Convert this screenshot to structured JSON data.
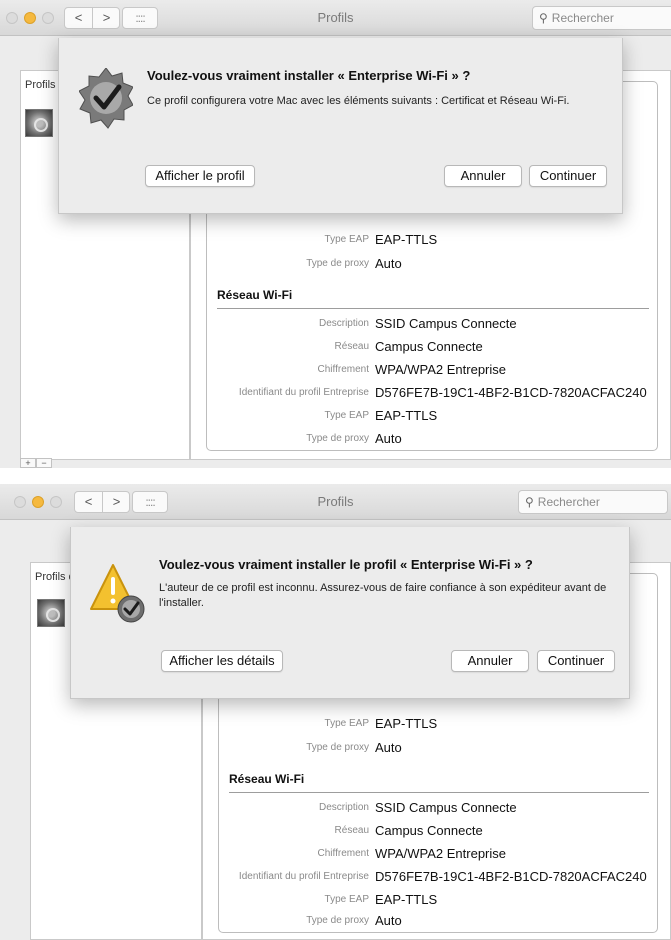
{
  "window": {
    "title": "Profils",
    "search_placeholder": "Rechercher",
    "nav_back": "<",
    "nav_forward": ">",
    "grid": "::::",
    "sidebar_label": "Profils d"
  },
  "dialogs": [
    {
      "title": "Voulez-vous vraiment installer « Enterprise Wi-Fi » ?",
      "body": "Ce profil configurera votre Mac avec les éléments suivants : Certificat et Réseau Wi-Fi.",
      "left_button": "Afficher le profil",
      "cancel_button": "Annuler",
      "continue_button": "Continuer",
      "icon": "checkmark-badge-icon"
    },
    {
      "title": "Voulez-vous vraiment installer le profil « Enterprise Wi-Fi » ?",
      "body": "L'auteur de ce profil est inconnu. Assurez-vous de faire confiance à son expéditeur avant de l'installer.",
      "left_button": "Afficher les détails",
      "cancel_button": "Annuler",
      "continue_button": "Continuer",
      "icon": "warning-triangle-icon"
    }
  ],
  "details": {
    "partial": [
      {
        "key": "Type EAP",
        "value": "EAP-TTLS"
      },
      {
        "key": "Type de proxy",
        "value": "Auto"
      }
    ],
    "wifi_section": "Réseau Wi-Fi",
    "wifi": [
      {
        "key": "Description",
        "value": "SSID Campus Connecte"
      },
      {
        "key": "Réseau",
        "value": "Campus Connecte"
      },
      {
        "key": "Chiffrement",
        "value": "WPA/WPA2 Entreprise"
      },
      {
        "key": "Identifiant du profil Entreprise",
        "value": "D576FE7B-19C1-4BF2-B1CD-7820ACFAC240"
      },
      {
        "key": "Type EAP",
        "value": "EAP-TTLS"
      },
      {
        "key": "Type de proxy",
        "value": "Auto"
      }
    ]
  },
  "footer": {
    "add": "+",
    "remove": "−"
  },
  "colors": {
    "minimize": "#f5b93f",
    "accent_line": "#9d9d9d"
  }
}
